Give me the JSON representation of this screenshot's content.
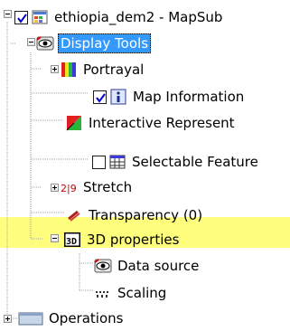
{
  "tree": {
    "root": {
      "label": "ethiopia_dem2 - MapSub",
      "checked": true,
      "expanded": true,
      "icon": "map-layer-icon"
    },
    "display_tools": {
      "label": "Display Tools",
      "expanded": true,
      "icon": "eye-icon"
    },
    "items": [
      {
        "label": "Portrayal",
        "icon": "color-bars-icon",
        "expandable": true
      },
      {
        "label": "Map Information",
        "icon": "info-icon",
        "checked": true
      },
      {
        "label": "Interactive Represent",
        "icon": "flag-icon"
      },
      {
        "label": "Selectable Feature",
        "icon": "table-icon",
        "checked": false
      },
      {
        "label": "Stretch",
        "icon": "stretch-icon",
        "expandable": true,
        "icon_text": "2|9"
      },
      {
        "label": "Transparency (0)",
        "icon": "transparency-icon"
      },
      {
        "label": "3D properties",
        "icon": "3d-icon",
        "expanded": true,
        "icon_text": "3D"
      }
    ],
    "sub_items": [
      {
        "label": "Data source",
        "icon": "eye-icon"
      },
      {
        "label": "Scaling",
        "icon": "scaling-icon"
      }
    ],
    "operations": {
      "label": "Operations",
      "icon": "folder-icon",
      "expandable": true
    }
  },
  "colors": {
    "selection": "#3399ff",
    "highlight": "#ffff66",
    "check_mark": "#0000cc"
  }
}
